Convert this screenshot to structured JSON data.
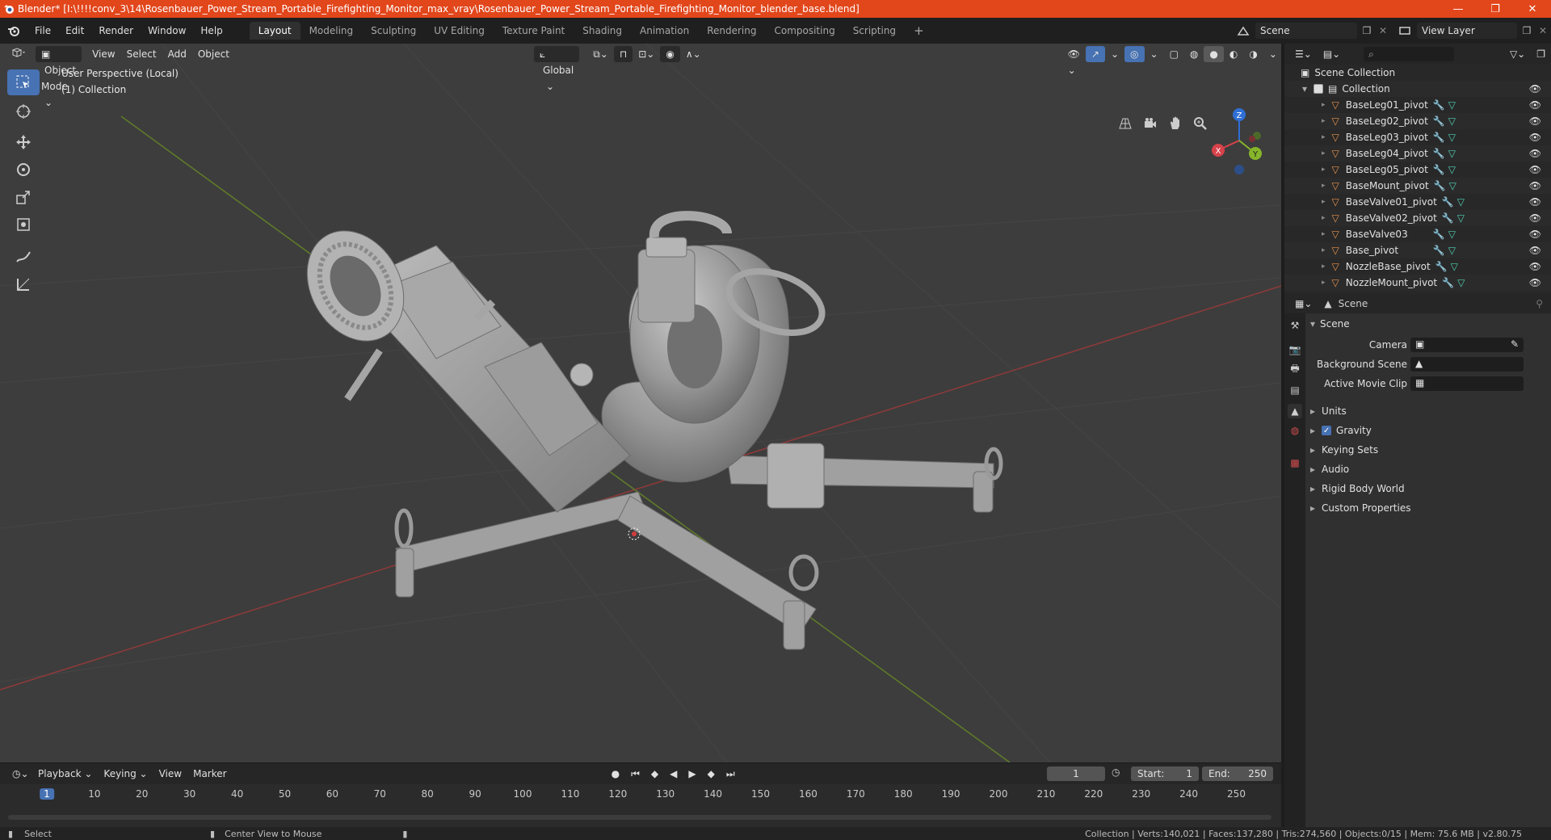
{
  "window": {
    "title": "Blender* [I:\\!!!!conv_3\\14\\Rosenbauer_Power_Stream_Portable_Firefighting_Monitor_max_vray\\Rosenbauer_Power_Stream_Portable_Firefighting_Monitor_blender_base.blend]",
    "controls": [
      "—",
      "❐",
      "✕"
    ]
  },
  "menu": [
    "File",
    "Edit",
    "Render",
    "Window",
    "Help"
  ],
  "workspaces": [
    "Layout",
    "Modeling",
    "Sculpting",
    "UV Editing",
    "Texture Paint",
    "Shading",
    "Animation",
    "Rendering",
    "Compositing",
    "Scripting"
  ],
  "active_workspace": "Layout",
  "scene_name": "Scene",
  "view_layer": "View Layer",
  "viewport": {
    "mode": "Object Mode",
    "menus": [
      "View",
      "Select",
      "Add",
      "Object"
    ],
    "orientation": "Global",
    "perspective": "User Perspective (Local)",
    "collection": "(1) Collection",
    "gizmo_axes": [
      "X",
      "Y",
      "Z"
    ],
    "accent": "#4772b3"
  },
  "timeline": {
    "menus": [
      "Playback",
      "Keying",
      "View",
      "Marker"
    ],
    "current_frame": "1",
    "start_label": "Start:",
    "start": "1",
    "end_label": "End:",
    "end": "250",
    "ticks": [
      "1",
      "10",
      "20",
      "30",
      "40",
      "50",
      "60",
      "70",
      "80",
      "90",
      "100",
      "110",
      "120",
      "130",
      "140",
      "150",
      "160",
      "170",
      "180",
      "190",
      "200",
      "210",
      "220",
      "230",
      "240",
      "250"
    ]
  },
  "status": {
    "left": "Select",
    "middle": "Center View to Mouse",
    "right": "Collection | Verts:140,021 | Faces:137,280 | Tris:274,560 | Objects:0/15 | Mem: 75.6 MB | v2.80.75"
  },
  "outliner": {
    "root": "Scene Collection",
    "collection": "Collection",
    "items": [
      "BaseLeg01_pivot",
      "BaseLeg02_pivot",
      "BaseLeg03_pivot",
      "BaseLeg04_pivot",
      "BaseLeg05_pivot",
      "BaseMount_pivot",
      "BaseValve01_pivot",
      "BaseValve02_pivot",
      "BaseValve03",
      "Base_pivot",
      "NozzleBase_pivot",
      "NozzleMount_pivot"
    ]
  },
  "properties": {
    "context": "Scene",
    "panel": "Scene",
    "fields": [
      {
        "label": "Camera"
      },
      {
        "label": "Background Scene"
      },
      {
        "label": "Active Movie Clip"
      }
    ],
    "sections": [
      "Units",
      "Gravity",
      "Keying Sets",
      "Audio",
      "Rigid Body World",
      "Custom Properties"
    ]
  }
}
